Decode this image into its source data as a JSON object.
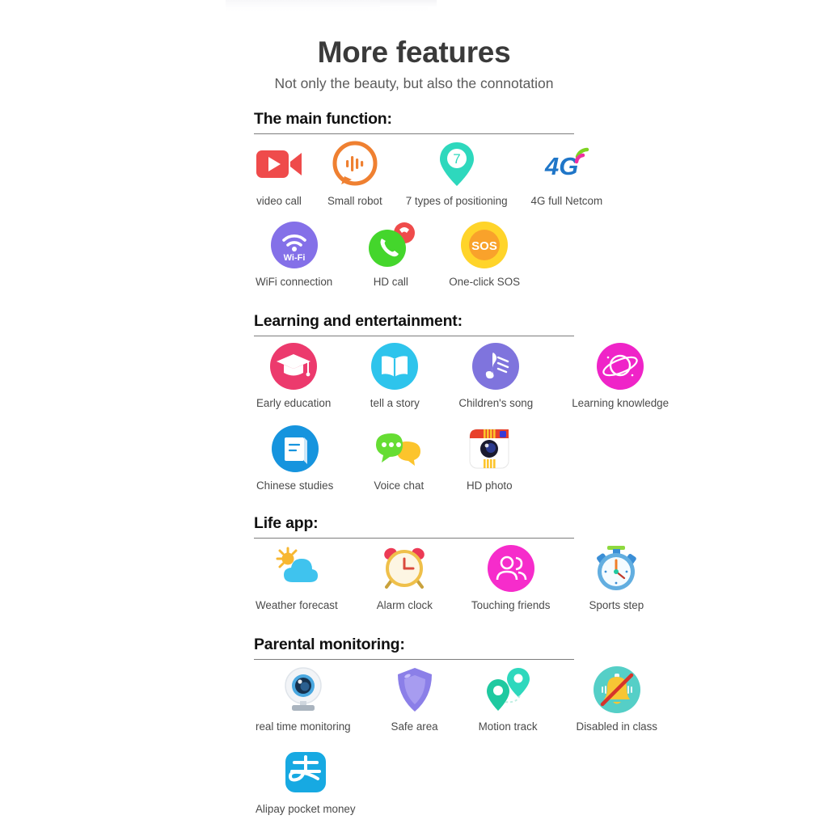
{
  "header": {
    "title": "More features",
    "subtitle": "Not only the beauty, but also the connotation"
  },
  "sections": [
    {
      "id": "main-function",
      "heading": "The main function:",
      "rows": [
        [
          {
            "icon": "video-camera-icon",
            "label": "video call",
            "color": "#ef4b4b"
          },
          {
            "icon": "sound-wave-bubble-icon",
            "label": "Small robot",
            "color": "#ef8031"
          },
          {
            "icon": "map-pin-seven-icon",
            "label": "7 types of positioning",
            "color": "#2ed8bd"
          },
          {
            "icon": "four-g-signal-icon",
            "label": "4G full Netcom",
            "color": "#1f76c8"
          }
        ],
        [
          {
            "icon": "wifi-icon",
            "label": "WiFi connection",
            "color": "#8470e8"
          },
          {
            "icon": "phone-call-icon",
            "label": "HD call",
            "color": "#44d62c"
          },
          {
            "icon": "sos-icon",
            "label": "One-click SOS",
            "color": "#ffd42a"
          }
        ]
      ]
    },
    {
      "id": "learning-entertainment",
      "heading": "Learning and entertainment:",
      "rows": [
        [
          {
            "icon": "graduation-cap-icon",
            "label": "Early education",
            "color": "#ec3a6d"
          },
          {
            "icon": "open-book-icon",
            "label": "tell a story",
            "color": "#2ec4ec"
          },
          {
            "icon": "music-note-icon",
            "label": "Children's song",
            "color": "#7f74dd"
          },
          {
            "icon": "planet-icon",
            "label": "Learning knowledge",
            "color": "#ef24c8"
          }
        ],
        [
          {
            "icon": "notebook-icon",
            "label": "Chinese studies",
            "color": "#1694de"
          },
          {
            "icon": "chat-bubbles-icon",
            "label": "Voice chat",
            "color": "#66dd33"
          },
          {
            "icon": "camera-photo-icon",
            "label": "HD photo",
            "color": "#e8402a"
          }
        ]
      ]
    },
    {
      "id": "life-app",
      "heading": "Life app:",
      "rows": [
        [
          {
            "icon": "sun-cloud-icon",
            "label": "Weather forecast",
            "color": "#3fc3ee"
          },
          {
            "icon": "alarm-clock-icon",
            "label": "Alarm clock",
            "color": "#efc04a"
          },
          {
            "icon": "two-people-icon",
            "label": "Touching friends",
            "color": "#f62ccb"
          },
          {
            "icon": "stopwatch-icon",
            "label": "Sports step",
            "color": "#3a8ed6"
          }
        ]
      ]
    },
    {
      "id": "parental-monitoring",
      "heading": "Parental monitoring:",
      "rows": [
        [
          {
            "icon": "webcam-icon",
            "label": "real time monitoring",
            "color": "#4aa8e0"
          },
          {
            "icon": "shield-icon",
            "label": "Safe area",
            "color": "#8b7fe8"
          },
          {
            "icon": "motion-track-icon",
            "label": "Motion track",
            "color": "#1fc9a0"
          },
          {
            "icon": "bell-disabled-icon",
            "label": "Disabled in class",
            "color": "#55cfc7"
          }
        ],
        [
          {
            "icon": "alipay-icon",
            "label": "Alipay pocket money",
            "color": "#17a9e2"
          }
        ]
      ]
    }
  ]
}
